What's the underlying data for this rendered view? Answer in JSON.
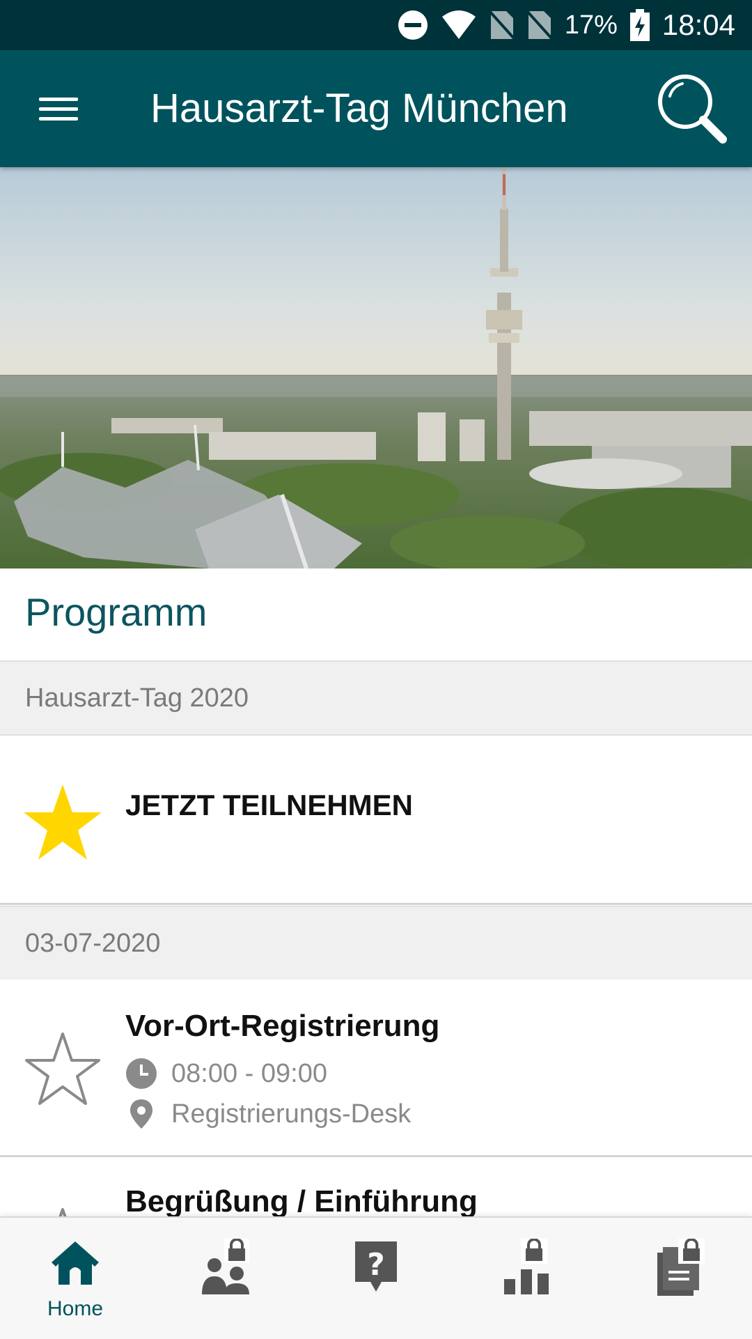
{
  "status_bar": {
    "battery": "17%",
    "time": "18:04",
    "icons": [
      "do-not-disturb-icon",
      "wifi-icon",
      "no-sim-icon",
      "no-sim-icon",
      "battery-charging-icon"
    ]
  },
  "app_bar": {
    "title": "Hausarzt-Tag München",
    "menu_icon": "hamburger-menu-icon",
    "search_icon": "search-icon"
  },
  "hero": {
    "image": "olympic-park-munich-tower-photo"
  },
  "program": {
    "section_title": "Programm",
    "groups": [
      {
        "header": "Hausarzt-Tag 2020",
        "items": [
          {
            "title": "JETZT TEILNEHMEN",
            "starred": true
          }
        ]
      },
      {
        "header": "03-07-2020",
        "items": [
          {
            "title": "Vor-Ort-Registrierung",
            "time": "08:00 - 09:00",
            "location": "Registrierungs-Desk",
            "starred": false
          },
          {
            "title": "Begrüßung / Einführung",
            "starred": false
          }
        ]
      }
    ]
  },
  "bottom_nav": {
    "tabs": [
      {
        "label": "Home",
        "icon": "home-icon",
        "active": true
      },
      {
        "label": "",
        "icon": "speakers-locked-icon"
      },
      {
        "label": "",
        "icon": "question-icon"
      },
      {
        "label": "",
        "icon": "sponsors-locked-icon"
      },
      {
        "label": "",
        "icon": "documents-locked-icon"
      }
    ]
  },
  "colors": {
    "status_bar": "#00323a",
    "app_bar": "#00535d",
    "accent": "#0b5560",
    "star_filled": "#ffd600",
    "group_header_bg": "#f0f0f0"
  }
}
